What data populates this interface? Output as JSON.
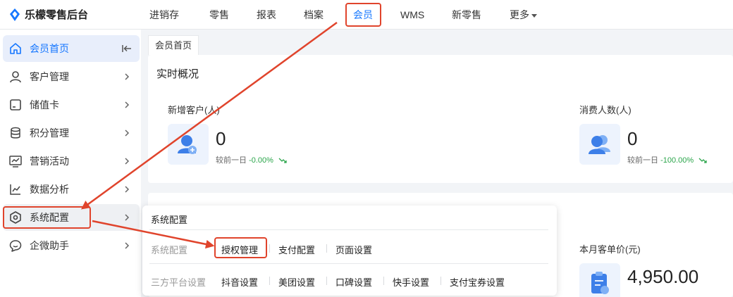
{
  "brand": {
    "name": "乐檬零售后台",
    "logo": "diamond-logo"
  },
  "topnav": [
    {
      "label": "进销存"
    },
    {
      "label": "零售"
    },
    {
      "label": "报表"
    },
    {
      "label": "档案"
    },
    {
      "label": "会员",
      "active": true
    },
    {
      "label": "WMS"
    },
    {
      "label": "新零售"
    },
    {
      "label": "更多",
      "has_dropdown": true
    }
  ],
  "sidebar": {
    "items": [
      {
        "label": "会员首页",
        "icon": "home-icon",
        "active": true
      },
      {
        "label": "客户管理",
        "icon": "user-icon"
      },
      {
        "label": "储值卡",
        "icon": "card-icon"
      },
      {
        "label": "积分管理",
        "icon": "coins-icon"
      },
      {
        "label": "营销活动",
        "icon": "chart-board-icon"
      },
      {
        "label": "数据分析",
        "icon": "line-chart-icon"
      },
      {
        "label": "系统配置",
        "icon": "settings-hex-icon"
      },
      {
        "label": "企微助手",
        "icon": "chat-icon"
      }
    ]
  },
  "tab": {
    "label": "会员首页"
  },
  "realtime": {
    "title": "实时概况",
    "metrics": [
      {
        "label": "新增客户(人)",
        "value": "0",
        "compare_label": "较前一日",
        "compare_value": "-0.00%"
      },
      {
        "label": "消费人数(人)",
        "value": "0",
        "compare_label": "较前一日",
        "compare_value": "-100.00%"
      }
    ]
  },
  "monthly": {
    "label": "本月客单价(元)",
    "value": "4,950.00"
  },
  "popover": {
    "title": "系统配置",
    "groups": [
      {
        "label": "系统配置",
        "links": [
          "授权管理",
          "支付配置",
          "页面设置"
        ]
      },
      {
        "label": "三方平台设置",
        "links": [
          "抖音设置",
          "美团设置",
          "口碑设置",
          "快手设置",
          "支付宝券设置"
        ]
      }
    ]
  },
  "colors": {
    "accent": "#1677ff",
    "highlight": "#e0442c",
    "up": "#2aa54a"
  }
}
